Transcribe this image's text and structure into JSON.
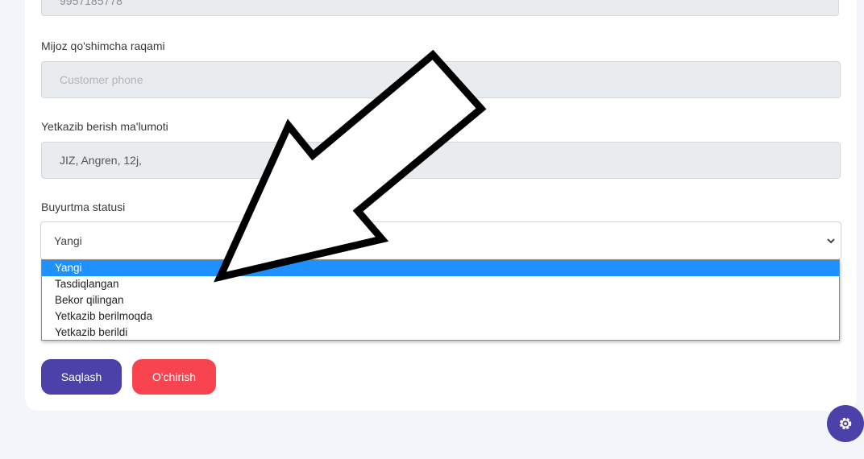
{
  "form": {
    "top_field_value": "9957185778",
    "extra_phone_label": "Mijoz qo'shimcha raqami",
    "extra_phone_placeholder": "Customer phone",
    "delivery_label": "Yetkazib berish ma'lumoti",
    "delivery_value": "JIZ, Angren, 12j,",
    "status_label": "Buyurtma statusi",
    "status_selected": "Yangi",
    "status_options": [
      "Yangi",
      "Tasdiqlangan",
      "Bekor qilingan",
      "Yetkazib berilmoqda",
      "Yetkazib berildi"
    ]
  },
  "buttons": {
    "save": "Saqlash",
    "delete": "O'chirish"
  },
  "icons": {
    "fab": "gear-icon",
    "select_arrow": "chevron-down-icon",
    "annotation": "arrow-annotation-icon"
  },
  "colors": {
    "primary": "#4b41a8",
    "danger": "#f7444e",
    "selected_option": "#1e90ff"
  }
}
